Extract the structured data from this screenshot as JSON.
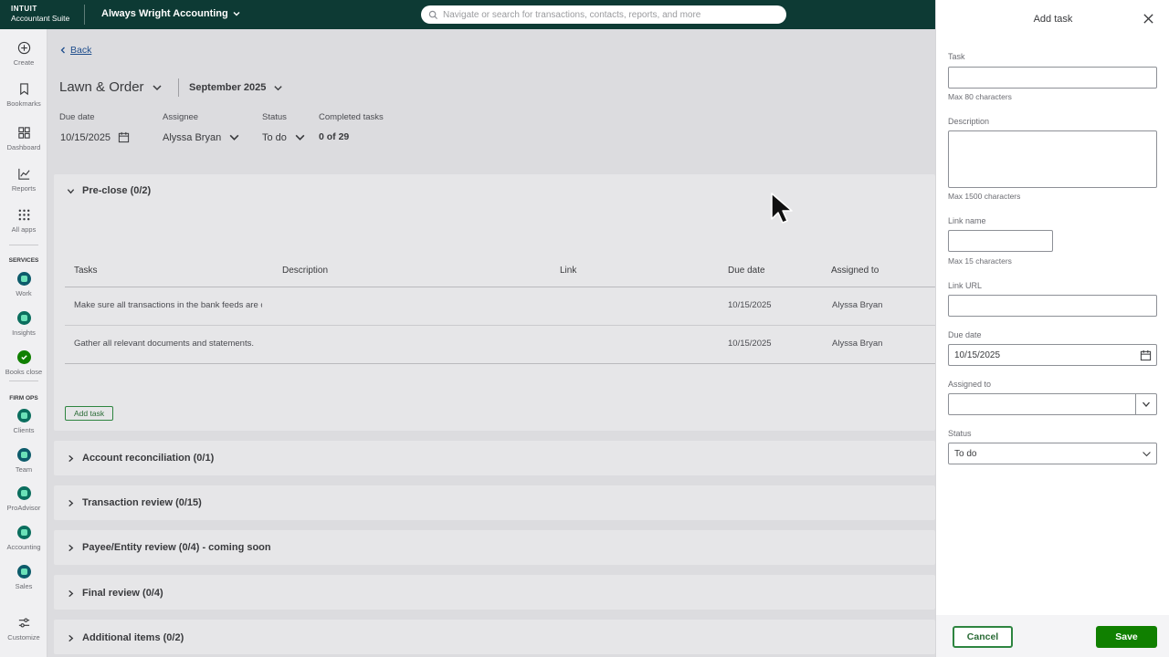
{
  "topbar": {
    "brand_top": "INTUIT",
    "brand_bottom": "Accountant Suite",
    "company": "Always Wright Accounting",
    "search_placeholder": "Navigate or search for transactions, contacts, reports, and more"
  },
  "rail": {
    "items": [
      "Create",
      "Bookmarks",
      "Dashboard",
      "Reports",
      "All apps"
    ],
    "services_header": "SERVICES",
    "services": [
      "Work",
      "Insights",
      "Books close"
    ],
    "firmops_header": "FIRM OPS",
    "firmops": [
      "Clients",
      "Team",
      "ProAdvisor",
      "Accounting",
      "Sales"
    ],
    "customize": "Customize"
  },
  "main": {
    "back": "Back",
    "title": "Lawn & Order",
    "period": "September 2025",
    "meta": {
      "due_date_label": "Due date",
      "due_date": "10/15/2025",
      "assignee_label": "Assignee",
      "assignee": "Alyssa Bryan",
      "status_label": "Status",
      "status": "To do",
      "completed_label": "Completed tasks",
      "completed": "0 of 29"
    },
    "preclose": {
      "title": "Pre-close (0/2)",
      "columns": [
        "Tasks",
        "Description",
        "Link",
        "Due date",
        "Assigned to"
      ],
      "rows": [
        {
          "task": "Make sure all transactions in the bank feeds are categorized",
          "description": "",
          "link": "",
          "due": "10/15/2025",
          "assigned": "Alyssa Bryan"
        },
        {
          "task": "Gather all relevant documents and statements.",
          "description": "",
          "link": "",
          "due": "10/15/2025",
          "assigned": "Alyssa Bryan"
        }
      ],
      "add_task": "Add task"
    },
    "sections": [
      "Account reconciliation (0/1)",
      "Transaction review (0/15)",
      "Payee/Entity review (0/4) - coming soon",
      "Final review (0/4)",
      "Additional items (0/2)"
    ]
  },
  "drawer": {
    "title": "Add task",
    "task_label": "Task",
    "task_value": "",
    "task_hint": "Max 80 characters",
    "description_label": "Description",
    "description_value": "",
    "description_hint": "Max 1500 characters",
    "link_name_label": "Link name",
    "link_name_value": "",
    "link_name_hint": "Max 15 characters",
    "link_url_label": "Link URL",
    "link_url_value": "",
    "due_label": "Due date",
    "due_value": "10/15/2025",
    "assigned_label": "Assigned to",
    "assigned_value": "",
    "status_label": "Status",
    "status_value": "To do",
    "cancel": "Cancel",
    "save": "Save"
  },
  "colors": {
    "topbar": "#0d3a34",
    "primary_green": "#108000",
    "link_blue": "#1e4d8c"
  }
}
